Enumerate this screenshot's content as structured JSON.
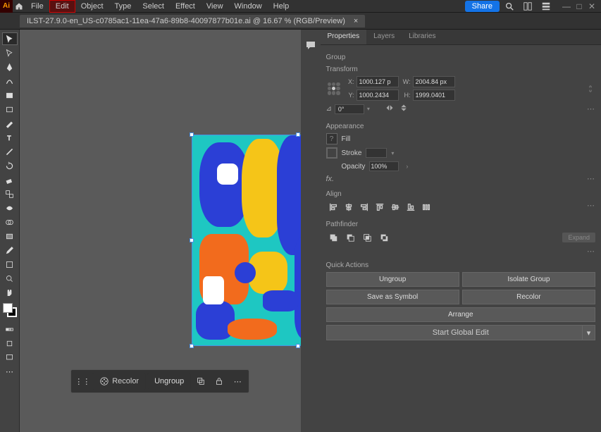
{
  "app": {
    "logo_text": "Ai"
  },
  "menu": {
    "file": "File",
    "edit": "Edit",
    "object": "Object",
    "type": "Type",
    "select": "Select",
    "effect": "Effect",
    "view": "View",
    "window": "Window",
    "help": "Help"
  },
  "topbar": {
    "share": "Share"
  },
  "document": {
    "tab_title": "ILST-27.9.0-en_US-c0785ac1-11ea-47a6-89b8-40097877b01e.ai @ 16.67 % (RGB/Preview)",
    "tab_close": "×"
  },
  "context": {
    "recolor": "Recolor",
    "ungroup": "Ungroup"
  },
  "panel_tabs": {
    "properties": "Properties",
    "layers": "Layers",
    "libraries": "Libraries"
  },
  "selection": {
    "type": "Group"
  },
  "transform": {
    "title": "Transform",
    "x_label": "X:",
    "x_value": "1000.127 p",
    "y_label": "Y:",
    "y_value": "1000.2434",
    "w_label": "W:",
    "w_value": "2004.84 px",
    "h_label": "H:",
    "h_value": "1999.0401",
    "rotate_value": "0°"
  },
  "appearance": {
    "title": "Appearance",
    "fill": "Fill",
    "stroke": "Stroke",
    "opacity": "Opacity",
    "stroke_value": "",
    "opacity_value": "100%",
    "fx": "fx."
  },
  "align": {
    "title": "Align"
  },
  "pathfinder": {
    "title": "Pathfinder",
    "expand": "Expand"
  },
  "quick_actions": {
    "title": "Quick Actions",
    "ungroup": "Ungroup",
    "isolate": "Isolate Group",
    "save_symbol": "Save as Symbol",
    "recolor": "Recolor",
    "arrange": "Arrange",
    "global_edit": "Start Global Edit"
  }
}
